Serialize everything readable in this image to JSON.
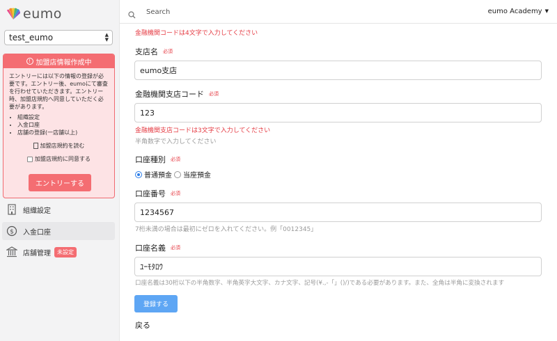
{
  "logo": {
    "text": "eumo"
  },
  "sidebar": {
    "account": "test_eumo",
    "notice": {
      "title": "加盟店情報作成中",
      "intro": "エントリーには以下の情報の登録が必要です。エントリー後、eumoにて審査を行わせていただきます。エントリー時、加盟店規約へ同意していただく必要があります。",
      "items": [
        "組織設定",
        "入金口座",
        "店舗の登録(一店舗以上)"
      ],
      "terms_link": "加盟店規約を読む",
      "agree_label": "加盟店規約に同意する",
      "entry_button": "エントリーする"
    },
    "nav": [
      {
        "label": "組織設定",
        "icon": "building-icon"
      },
      {
        "label": "入金口座",
        "icon": "dollar-icon",
        "active": true
      },
      {
        "label": "店舗管理",
        "icon": "store-icon",
        "badge": "未設定"
      }
    ]
  },
  "header": {
    "search_placeholder": "Search",
    "user_menu": "eumo Academy"
  },
  "form": {
    "bank_code_error": "金融機関コードは4文字で入力してください",
    "branch_name": {
      "label": "支店名",
      "required": "必須",
      "value": "eumo支店"
    },
    "branch_code": {
      "label": "金融機関支店コード",
      "required": "必須",
      "value": "123",
      "error": "金融機関支店コードは3文字で入力してください",
      "help": "半角数字で入力してください"
    },
    "account_type": {
      "label": "口座種別",
      "required": "必須",
      "options": [
        "普通預金",
        "当座預金"
      ],
      "selected": "普通預金"
    },
    "account_number": {
      "label": "口座番号",
      "required": "必須",
      "value": "1234567",
      "help": "7桁未満の場合は最初にゼロを入れてください。例「0012345」"
    },
    "account_name": {
      "label": "口座名義",
      "required": "必須",
      "value": "ﾕｰﾓﾀﾛｳ",
      "help": "口座名義は30桁以下の半角数字、半角英字大文字、カナ文字、記号(¥.,-「」()/)である必要があります。また、全角は半角に変換されます"
    },
    "submit_button": "登録する",
    "back_link": "戻る"
  },
  "colors": {
    "accent_red": "#f46d72",
    "error_red": "#e53b43",
    "primary_blue": "#5ea6f4"
  }
}
